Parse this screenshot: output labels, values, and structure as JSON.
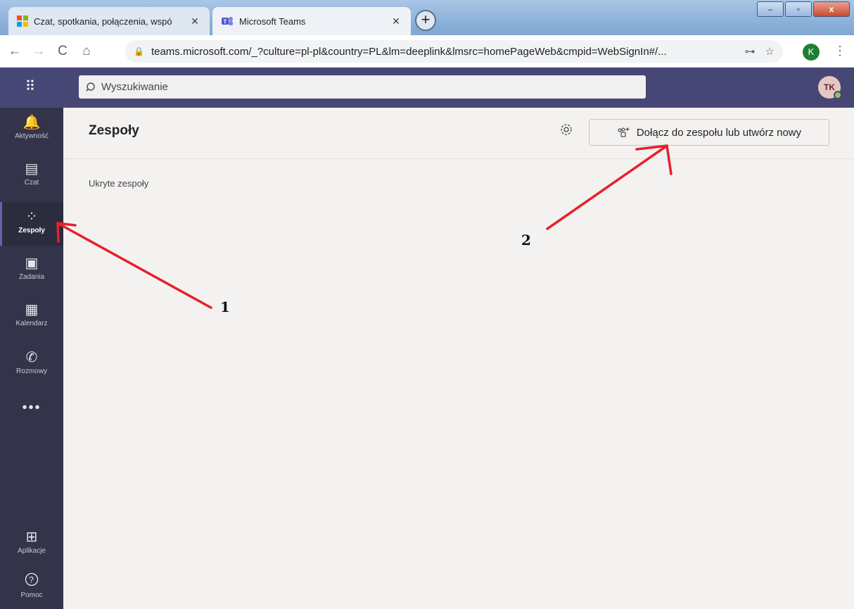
{
  "browser": {
    "tabs": [
      {
        "title": "Czat, spotkania, połączenia, wspó",
        "close": "✕"
      },
      {
        "title": "Microsoft Teams",
        "close": "✕"
      }
    ],
    "new_tab": "+",
    "window_buttons": {
      "minimize": "–",
      "maximize": "▫",
      "close": "x"
    },
    "nav": {
      "back": "←",
      "forward": "→",
      "reload": "C",
      "home": "⌂"
    },
    "url": "teams.microsoft.com/_?culture=pl-pl&country=PL&lm=deeplink&lmsrc=homePageWeb&cmpid=WebSignIn#/...",
    "profile_initial": "K",
    "menu": "⋮",
    "key_icon": "⊶",
    "star_icon": "☆",
    "lock_icon": "🔒"
  },
  "header": {
    "search_placeholder": "Wyszukiwanie",
    "avatar_initials": "TK",
    "app_launcher": "⠿"
  },
  "rail": {
    "items": [
      {
        "label": "Aktywność",
        "icon": "bell-icon",
        "glyph": "🔔"
      },
      {
        "label": "Czat",
        "icon": "chat-icon",
        "glyph": "▤"
      },
      {
        "label": "Zespoły",
        "icon": "teams-icon",
        "glyph": "⁘",
        "active": true
      },
      {
        "label": "Zadania",
        "icon": "assignments-icon",
        "glyph": "▣"
      },
      {
        "label": "Kalendarz",
        "icon": "calendar-icon",
        "glyph": "▦"
      },
      {
        "label": "Rozmowy",
        "icon": "phone-icon",
        "glyph": "✆"
      },
      {
        "label": "Aplikacje",
        "icon": "apps-icon",
        "glyph": "⊞"
      },
      {
        "label": "Pomoc",
        "icon": "help-icon",
        "glyph": "?"
      }
    ],
    "more": "•••"
  },
  "main": {
    "title": "Zespoły",
    "join_button": "Dołącz do zespołu lub utwórz nowy",
    "hidden_teams": "Ukryte zespoły"
  },
  "annotations": {
    "marker_1": "1",
    "marker_2": "2",
    "arrow_color": "#e8202a"
  }
}
